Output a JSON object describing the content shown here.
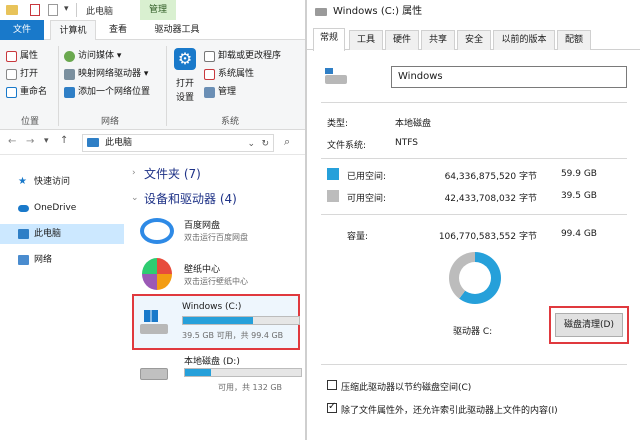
{
  "explorer": {
    "title": "此电脑",
    "context_tab": "管理",
    "tabs": [
      "文件",
      "计算机",
      "查看",
      "驱动器工具"
    ],
    "ribbon": {
      "location_items": [
        "属性",
        "打开",
        "重命名"
      ],
      "location_label": "位置",
      "network_items": [
        "访问媒体 ▾",
        "映射网络驱动器 ▾",
        "添加一个网络位置"
      ],
      "network_label": "网络",
      "open_settings": "打开\n设置",
      "open_settings_l1": "打开",
      "open_settings_l2": "设置",
      "system_items": [
        "卸载或更改程序",
        "系统属性",
        "管理"
      ],
      "system_label": "系统"
    },
    "address": "此电脑",
    "nav": [
      "快速访问",
      "OneDrive",
      "此电脑",
      "网络"
    ],
    "sections": {
      "folders": "文件夹 (7)",
      "devices": "设备和驱动器 (4)"
    },
    "devices": [
      {
        "name": "百度网盘",
        "sub": "双击运行百度网盘"
      },
      {
        "name": "壁纸中心",
        "sub": "双击运行壁纸中心"
      }
    ],
    "drives": [
      {
        "name": "Windows (C:)",
        "free": "39.5 GB 可用，共 99.4 GB",
        "used_fraction": 0.6
      },
      {
        "name": "本地磁盘 (D:)",
        "free": "可用，共 132 GB",
        "used_fraction": 0.22
      }
    ]
  },
  "dialog": {
    "title": "Windows (C:) 属性",
    "tabs": [
      "常规",
      "工具",
      "硬件",
      "共享",
      "安全",
      "以前的版本",
      "配额"
    ],
    "name_value": "Windows",
    "type_label": "类型:",
    "type_value": "本地磁盘",
    "fs_label": "文件系统:",
    "fs_value": "NTFS",
    "used_label": "已用空间:",
    "used_bytes": "64,336,875,520 字节",
    "used_gb": "59.9 GB",
    "free_label": "可用空间:",
    "free_bytes": "42,433,708,032 字节",
    "free_gb": "39.5 GB",
    "capacity_label": "容量:",
    "capacity_bytes": "106,770,583,552 字节",
    "capacity_gb": "99.4 GB",
    "drive_label": "驱动器 C:",
    "cleanup_button": "磁盘清理(D)",
    "compress_option": "压缩此驱动器以节约磁盘空间(C)",
    "index_option": "除了文件属性外，还允许索引此驱动器上文件的内容(I)",
    "used_fraction": 0.603,
    "colors": {
      "used": "#26a0da",
      "free": "#bcbcbc"
    }
  }
}
